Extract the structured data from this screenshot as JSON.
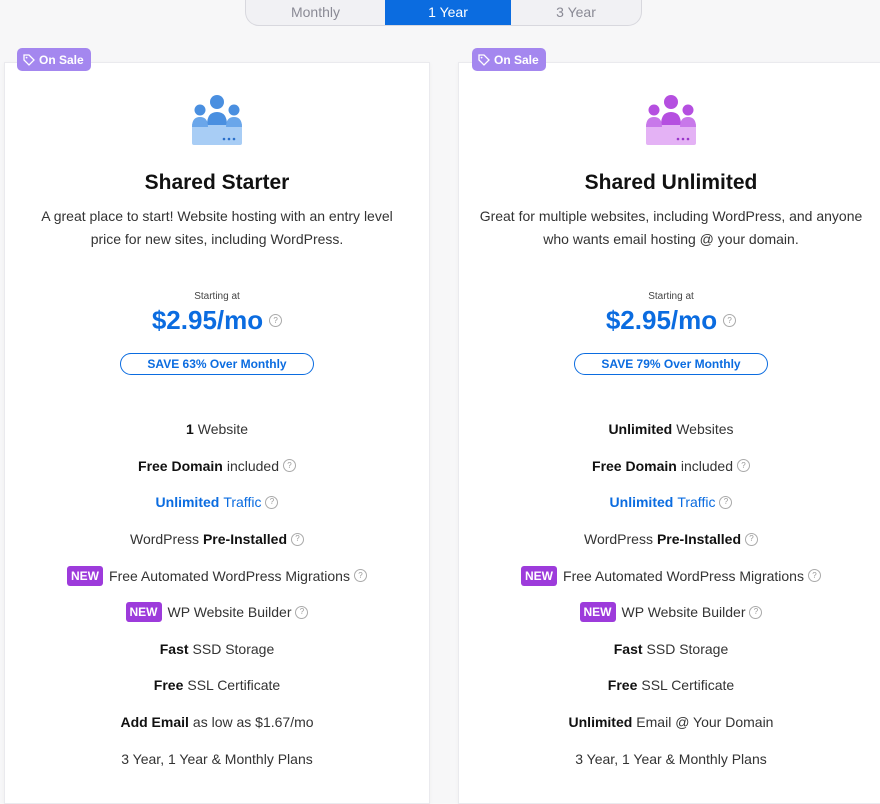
{
  "tabs": [
    {
      "label": "Monthly",
      "active": false
    },
    {
      "label": "1 Year",
      "active": true
    },
    {
      "label": "3 Year",
      "active": false
    }
  ],
  "accent_color": "#0b6ce0",
  "sale_badge_color": "#a487ef",
  "new_badge_color": "#9d3bdb",
  "plans": [
    {
      "sale_badge": "On Sale",
      "icon": "team-users-icon",
      "title": "Shared Starter",
      "description": "A great place to start! Website hosting with an entry level price for new sites, including WordPress.",
      "starting_label": "Starting at",
      "price": "$2.95/mo",
      "save": "SAVE 63% Over Monthly",
      "features": [
        {
          "bold": "1",
          "text": " Website"
        },
        {
          "bold": "Free Domain",
          "text": " included"
        },
        {
          "blue": "Unlimited",
          "text": " Traffic"
        },
        {
          "text": "WordPress ",
          "bold": "Pre-Installed"
        },
        {
          "badge": "NEW",
          "text": "Free Automated WordPress Migrations"
        },
        {
          "badge": "NEW",
          "text": "WP Website Builder"
        },
        {
          "bold": "Fast",
          "text": " SSD Storage"
        },
        {
          "bold": "Free",
          "text": " SSL Certificate"
        },
        {
          "bold": "Add Email",
          "text": " as low as $1.67/mo"
        },
        {
          "text": "3 Year, 1 Year & Monthly Plans"
        }
      ]
    },
    {
      "sale_badge": "On Sale",
      "icon": "team-users-icon",
      "title": "Shared Unlimited",
      "description": "Great for multiple websites, including WordPress, and anyone who wants email hosting @ your domain.",
      "starting_label": "Starting at",
      "price": "$2.95/mo",
      "save": "SAVE 79% Over Monthly",
      "features": [
        {
          "bold": "Unlimited",
          "text": " Websites"
        },
        {
          "bold": "Free Domain",
          "text": " included"
        },
        {
          "blue": "Unlimited",
          "text": " Traffic"
        },
        {
          "text": "WordPress ",
          "bold": "Pre-Installed"
        },
        {
          "badge": "NEW",
          "text": "Free Automated WordPress Migrations"
        },
        {
          "badge": "NEW",
          "text": "WP Website Builder"
        },
        {
          "bold": "Fast",
          "text": " SSD Storage"
        },
        {
          "bold": "Free",
          "text": " SSL Certificate"
        },
        {
          "bold": "Unlimited",
          "text": " Email @ Your Domain"
        },
        {
          "text": "3 Year, 1 Year & Monthly Plans"
        }
      ]
    }
  ]
}
